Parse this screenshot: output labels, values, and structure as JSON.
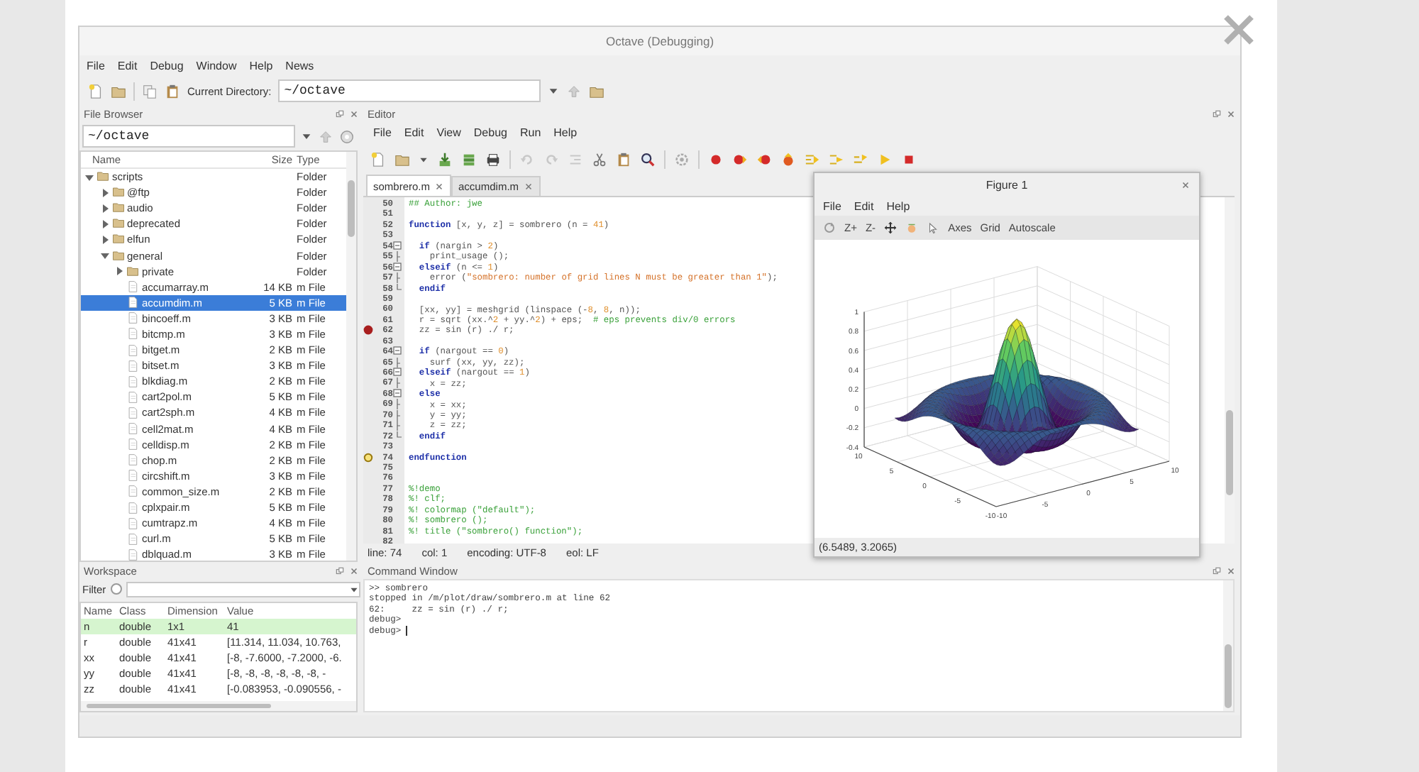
{
  "window": {
    "title": "Octave (Debugging)"
  },
  "menu": [
    "File",
    "Edit",
    "Debug",
    "Window",
    "Help",
    "News"
  ],
  "toolbar": {
    "directory_label": "Current Directory:",
    "directory": "~/octave"
  },
  "file_browser": {
    "title": "File Browser",
    "path": "~/octave",
    "columns": [
      "Name",
      "Size",
      "Type"
    ],
    "tree": [
      {
        "kind": "folder",
        "name": "scripts",
        "type": "Folder",
        "expanded": true,
        "selected": false,
        "children": [
          {
            "kind": "folder",
            "name": "@ftp",
            "type": "Folder",
            "expanded": false,
            "selected": false
          },
          {
            "kind": "folder",
            "name": "audio",
            "type": "Folder",
            "expanded": false,
            "selected": false
          },
          {
            "kind": "folder",
            "name": "deprecated",
            "type": "Folder",
            "expanded": false,
            "selected": false
          },
          {
            "kind": "folder",
            "name": "elfun",
            "type": "Folder",
            "expanded": false,
            "selected": false
          },
          {
            "kind": "folder",
            "name": "general",
            "type": "Folder",
            "expanded": true,
            "selected": false,
            "children": [
              {
                "kind": "folder",
                "name": "private",
                "type": "Folder",
                "expanded": false,
                "selected": false
              },
              {
                "kind": "file",
                "name": "accumarray.m",
                "size": "14 KB",
                "type": "m File",
                "selected": false
              },
              {
                "kind": "file",
                "name": "accumdim.m",
                "size": "5 KB",
                "type": "m File",
                "selected": true
              },
              {
                "kind": "file",
                "name": "bincoeff.m",
                "size": "3 KB",
                "type": "m File",
                "selected": false
              },
              {
                "kind": "file",
                "name": "bitcmp.m",
                "size": "3 KB",
                "type": "m File",
                "selected": false
              },
              {
                "kind": "file",
                "name": "bitget.m",
                "size": "2 KB",
                "type": "m File",
                "selected": false
              },
              {
                "kind": "file",
                "name": "bitset.m",
                "size": "3 KB",
                "type": "m File",
                "selected": false
              },
              {
                "kind": "file",
                "name": "blkdiag.m",
                "size": "2 KB",
                "type": "m File",
                "selected": false
              },
              {
                "kind": "file",
                "name": "cart2pol.m",
                "size": "5 KB",
                "type": "m File",
                "selected": false
              },
              {
                "kind": "file",
                "name": "cart2sph.m",
                "size": "4 KB",
                "type": "m File",
                "selected": false
              },
              {
                "kind": "file",
                "name": "cell2mat.m",
                "size": "4 KB",
                "type": "m File",
                "selected": false
              },
              {
                "kind": "file",
                "name": "celldisp.m",
                "size": "2 KB",
                "type": "m File",
                "selected": false
              },
              {
                "kind": "file",
                "name": "chop.m",
                "size": "2 KB",
                "type": "m File",
                "selected": false
              },
              {
                "kind": "file",
                "name": "circshift.m",
                "size": "3 KB",
                "type": "m File",
                "selected": false
              },
              {
                "kind": "file",
                "name": "common_size.m",
                "size": "2 KB",
                "type": "m File",
                "selected": false
              },
              {
                "kind": "file",
                "name": "cplxpair.m",
                "size": "5 KB",
                "type": "m File",
                "selected": false
              },
              {
                "kind": "file",
                "name": "cumtrapz.m",
                "size": "4 KB",
                "type": "m File",
                "selected": false
              },
              {
                "kind": "file",
                "name": "curl.m",
                "size": "5 KB",
                "type": "m File",
                "selected": false
              },
              {
                "kind": "file",
                "name": "dblquad.m",
                "size": "3 KB",
                "type": "m File",
                "selected": false
              }
            ]
          }
        ]
      }
    ]
  },
  "editor": {
    "title": "Editor",
    "menu": [
      "File",
      "Edit",
      "View",
      "Debug",
      "Run",
      "Help"
    ],
    "tabs": [
      {
        "label": "sombrero.m",
        "selected": true
      },
      {
        "label": "accumdim.m",
        "selected": false
      }
    ],
    "lines": [
      {
        "number": "50",
        "breakpoint": false,
        "current": false,
        "fold_start": false,
        "in_fold": false,
        "parts": [
          {
            "kind": "comment",
            "text": "## Author: jwe"
          }
        ]
      },
      {
        "number": "51",
        "breakpoint": false,
        "current": false,
        "fold_start": false,
        "in_fold": false
      },
      {
        "number": "52",
        "breakpoint": false,
        "current": false,
        "fold_start": false,
        "in_fold": false,
        "parts": [
          {
            "kind": "keyword",
            "text": "function"
          },
          {
            "kind": "plain",
            "text": " [x, y, z] = sombrero (n = "
          },
          {
            "kind": "number",
            "text": "41"
          },
          {
            "kind": "plain",
            "text": ")"
          }
        ]
      },
      {
        "number": "53",
        "breakpoint": false,
        "current": false,
        "fold_start": false,
        "in_fold": false
      },
      {
        "number": "54",
        "breakpoint": false,
        "current": false,
        "fold_start": true,
        "in_fold": false,
        "parts": [
          {
            "kind": "keyword",
            "text": "  if"
          },
          {
            "kind": "plain",
            "text": " (nargin > "
          },
          {
            "kind": "number",
            "text": "2"
          },
          {
            "kind": "plain",
            "text": ")"
          }
        ]
      },
      {
        "number": "55",
        "breakpoint": false,
        "current": false,
        "fold_start": false,
        "in_fold": true,
        "parts": [
          {
            "kind": "plain",
            "text": "    print_usage ();"
          }
        ]
      },
      {
        "number": "56",
        "breakpoint": false,
        "current": false,
        "fold_start": true,
        "in_fold": false,
        "parts": [
          {
            "kind": "keyword",
            "text": "  elseif"
          },
          {
            "kind": "plain",
            "text": " (n <= "
          },
          {
            "kind": "number",
            "text": "1"
          },
          {
            "kind": "plain",
            "text": ")"
          }
        ]
      },
      {
        "number": "57",
        "breakpoint": false,
        "current": false,
        "fold_start": false,
        "in_fold": true,
        "parts": [
          {
            "kind": "plain",
            "text": "    error ("
          },
          {
            "kind": "string",
            "text": "\"sombrero: number of grid lines N must be greater than 1\""
          },
          {
            "kind": "plain",
            "text": ");"
          }
        ]
      },
      {
        "number": "58",
        "breakpoint": false,
        "current": false,
        "fold_start": false,
        "in_fold": true,
        "parts": [
          {
            "kind": "keyword",
            "text": "  endif"
          }
        ]
      },
      {
        "number": "59",
        "breakpoint": false,
        "current": false,
        "fold_start": false,
        "in_fold": false
      },
      {
        "number": "60",
        "breakpoint": false,
        "current": false,
        "fold_start": false,
        "in_fold": false,
        "parts": [
          {
            "kind": "plain",
            "text": "  [xx, yy] = meshgrid (linspace (-"
          },
          {
            "kind": "number",
            "text": "8"
          },
          {
            "kind": "plain",
            "text": ", "
          },
          {
            "kind": "number",
            "text": "8"
          },
          {
            "kind": "plain",
            "text": ", n));"
          }
        ]
      },
      {
        "number": "61",
        "breakpoint": false,
        "current": false,
        "fold_start": false,
        "in_fold": false,
        "parts": [
          {
            "kind": "plain",
            "text": "  r = sqrt (xx.^"
          },
          {
            "kind": "number",
            "text": "2"
          },
          {
            "kind": "plain",
            "text": " + yy.^"
          },
          {
            "kind": "number",
            "text": "2"
          },
          {
            "kind": "plain",
            "text": ") + eps;  "
          },
          {
            "kind": "comment",
            "text": "# eps prevents div/0 errors"
          }
        ]
      },
      {
        "number": "62",
        "breakpoint": true,
        "current": false,
        "fold_start": false,
        "in_fold": false,
        "parts": [
          {
            "kind": "plain",
            "text": "  zz = sin (r) ./ r;"
          }
        ]
      },
      {
        "number": "63",
        "breakpoint": false,
        "current": false,
        "fold_start": false,
        "in_fold": false
      },
      {
        "number": "64",
        "breakpoint": false,
        "current": false,
        "fold_start": true,
        "in_fold": false,
        "parts": [
          {
            "kind": "keyword",
            "text": "  if"
          },
          {
            "kind": "plain",
            "text": " (nargout == "
          },
          {
            "kind": "number",
            "text": "0"
          },
          {
            "kind": "plain",
            "text": ")"
          }
        ]
      },
      {
        "number": "65",
        "breakpoint": false,
        "current": false,
        "fold_start": false,
        "in_fold": true,
        "parts": [
          {
            "kind": "plain",
            "text": "    surf (xx, yy, zz);"
          }
        ]
      },
      {
        "number": "66",
        "breakpoint": false,
        "current": false,
        "fold_start": true,
        "in_fold": false,
        "parts": [
          {
            "kind": "keyword",
            "text": "  elseif"
          },
          {
            "kind": "plain",
            "text": " (nargout == "
          },
          {
            "kind": "number",
            "text": "1"
          },
          {
            "kind": "plain",
            "text": ")"
          }
        ]
      },
      {
        "number": "67",
        "breakpoint": false,
        "current": false,
        "fold_start": false,
        "in_fold": true,
        "parts": [
          {
            "kind": "plain",
            "text": "    x = zz;"
          }
        ]
      },
      {
        "number": "68",
        "breakpoint": false,
        "current": false,
        "fold_start": true,
        "in_fold": false,
        "parts": [
          {
            "kind": "keyword",
            "text": "  else"
          }
        ]
      },
      {
        "number": "69",
        "breakpoint": false,
        "current": false,
        "fold_start": false,
        "in_fold": true,
        "parts": [
          {
            "kind": "plain",
            "text": "    x = xx;"
          }
        ]
      },
      {
        "number": "70",
        "breakpoint": false,
        "current": false,
        "fold_start": false,
        "in_fold": true,
        "parts": [
          {
            "kind": "plain",
            "text": "    y = yy;"
          }
        ]
      },
      {
        "number": "71",
        "breakpoint": false,
        "current": false,
        "fold_start": false,
        "in_fold": true,
        "parts": [
          {
            "kind": "plain",
            "text": "    z = zz;"
          }
        ]
      },
      {
        "number": "72",
        "breakpoint": false,
        "current": false,
        "fold_start": false,
        "in_fold": true,
        "parts": [
          {
            "kind": "keyword",
            "text": "  endif"
          }
        ]
      },
      {
        "number": "73",
        "breakpoint": false,
        "current": false,
        "fold_start": false,
        "in_fold": false
      },
      {
        "number": "74",
        "breakpoint": false,
        "current": true,
        "fold_start": false,
        "in_fold": false,
        "parts": [
          {
            "kind": "keyword",
            "text": "endfunction"
          }
        ]
      },
      {
        "number": "75",
        "breakpoint": false,
        "current": false,
        "fold_start": false,
        "in_fold": false
      },
      {
        "number": "76",
        "breakpoint": false,
        "current": false,
        "fold_start": false,
        "in_fold": false
      },
      {
        "number": "77",
        "breakpoint": false,
        "current": false,
        "fold_start": false,
        "in_fold": false,
        "parts": [
          {
            "kind": "comment",
            "text": "%!demo"
          }
        ]
      },
      {
        "number": "78",
        "breakpoint": false,
        "current": false,
        "fold_start": false,
        "in_fold": false,
        "parts": [
          {
            "kind": "comment",
            "text": "%! clf;"
          }
        ]
      },
      {
        "number": "79",
        "breakpoint": false,
        "current": false,
        "fold_start": false,
        "in_fold": false,
        "parts": [
          {
            "kind": "comment",
            "text": "%! colormap (\"default\");"
          }
        ]
      },
      {
        "number": "80",
        "breakpoint": false,
        "current": false,
        "fold_start": false,
        "in_fold": false,
        "parts": [
          {
            "kind": "comment",
            "text": "%! sombrero ();"
          }
        ]
      },
      {
        "number": "81",
        "breakpoint": false,
        "current": false,
        "fold_start": false,
        "in_fold": false,
        "parts": [
          {
            "kind": "comment",
            "text": "%! title (\"sombrero() function\");"
          }
        ]
      },
      {
        "number": "82",
        "breakpoint": false,
        "current": false,
        "fold_start": false,
        "in_fold": false
      }
    ],
    "status": [
      "line: 74",
      "col: 1",
      "encoding: UTF-8",
      "eol: LF"
    ]
  },
  "figure": {
    "title": "Figure 1",
    "menu": [
      "File",
      "Edit",
      "Help"
    ],
    "zoom_tools": [
      "Z+",
      "Z-"
    ],
    "buttons": [
      "Axes",
      "Grid",
      "Autoscale"
    ],
    "z_ticks": [
      "1",
      "0.8",
      "0.6",
      "0.4",
      "0.2",
      "0",
      "-0.2",
      "-0.4"
    ],
    "x_ticks": [
      "10",
      "5",
      "0",
      "-5",
      "-10"
    ],
    "y_ticks": [
      "-10",
      "-5",
      "0",
      "5",
      "10"
    ],
    "status": "(6.5489, 3.2065)"
  },
  "workspace": {
    "title": "Workspace",
    "filter_label": "Filter",
    "filter_enabled": false,
    "columns": [
      "Name",
      "Class",
      "Dimension",
      "Value"
    ],
    "rows": [
      {
        "cells": [
          "n",
          "double",
          "1x1",
          "41"
        ],
        "highlighted": true
      },
      {
        "cells": [
          "r",
          "double",
          "41x41",
          "[11.314, 11.034, 10.763,"
        ],
        "highlighted": false
      },
      {
        "cells": [
          "xx",
          "double",
          "41x41",
          "[-8, -7.6000, -7.2000, -6."
        ],
        "highlighted": false
      },
      {
        "cells": [
          "yy",
          "double",
          "41x41",
          "[-8, -8, -8, -8, -8, -8, -"
        ],
        "highlighted": false
      },
      {
        "cells": [
          "zz",
          "double",
          "41x41",
          "[-0.083953, -0.090556, -"
        ],
        "highlighted": false
      }
    ]
  },
  "command_window": {
    "title": "Command Window",
    "lines": [
      ">> sombrero",
      "stopped in /m/plot/draw/sombrero.m at line 62",
      "62:     zz = sin (r) ./ r;",
      "debug>",
      "debug>"
    ]
  }
}
